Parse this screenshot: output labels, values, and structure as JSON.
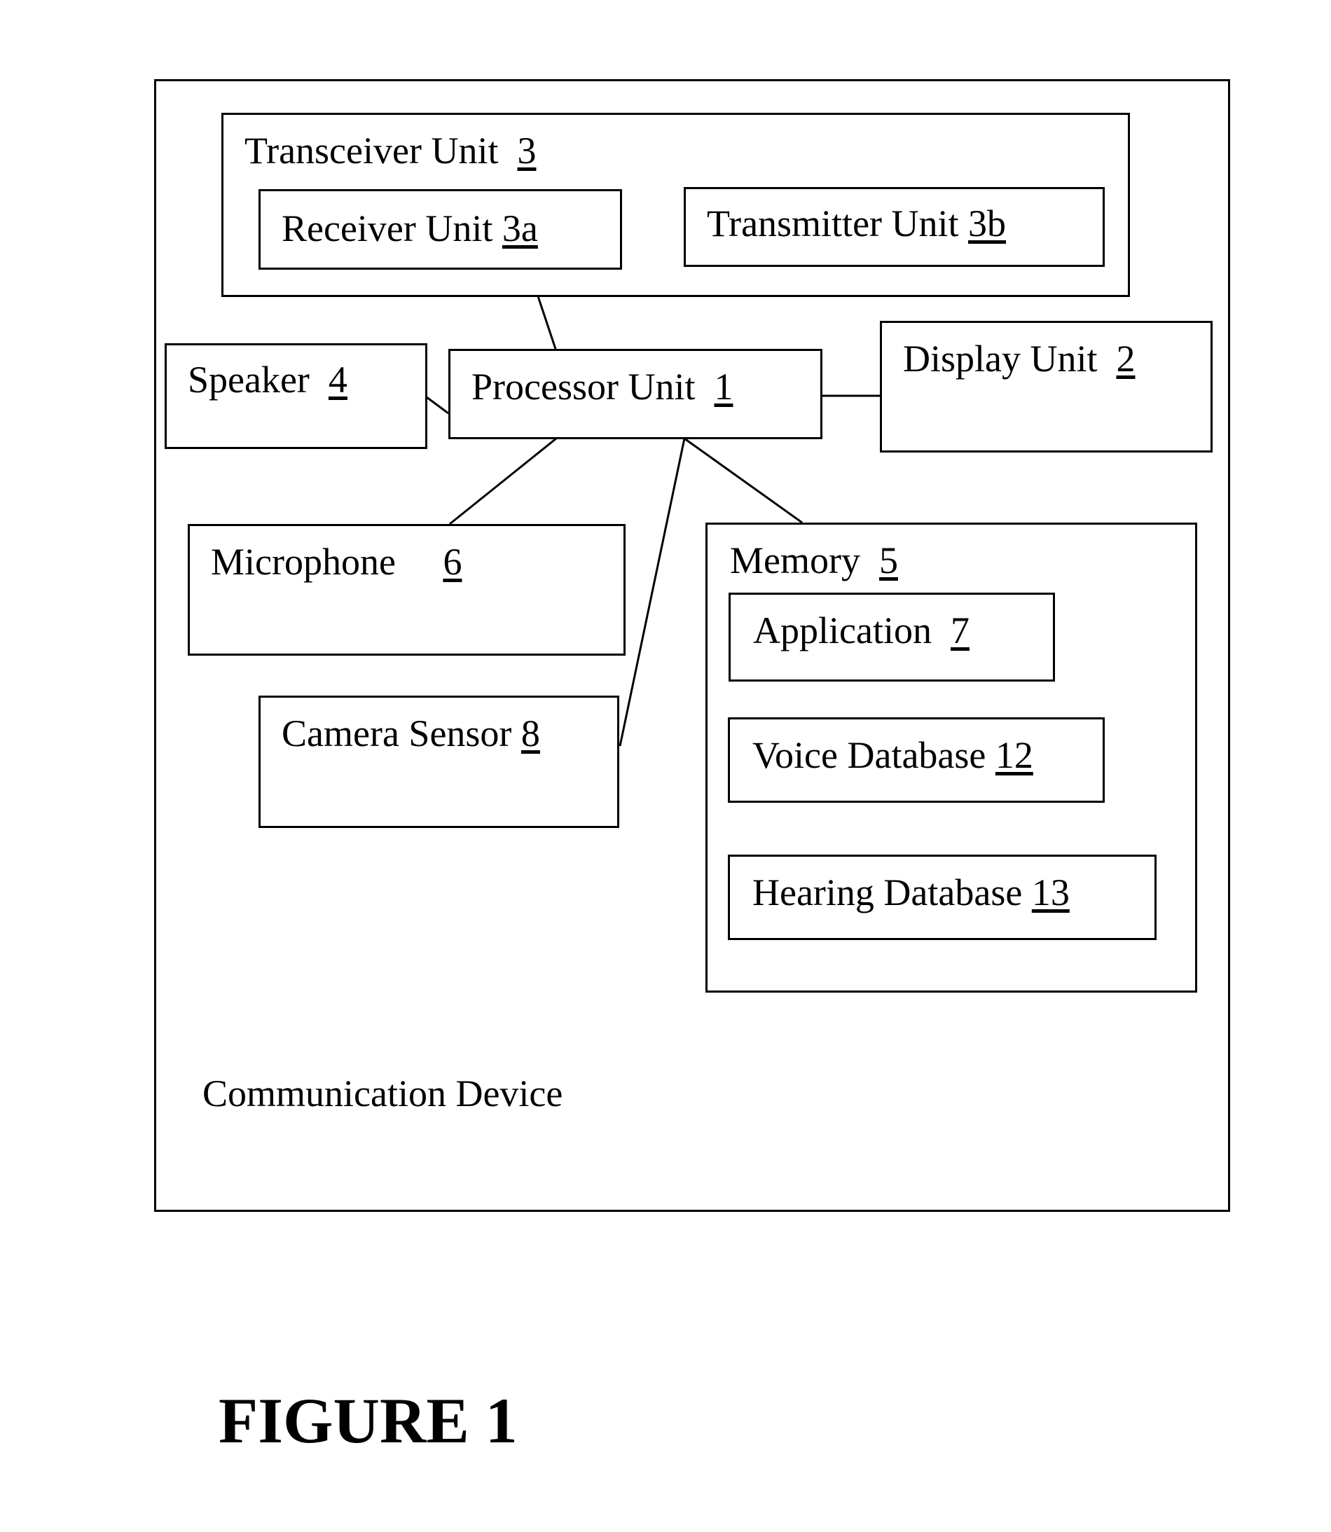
{
  "figure": {
    "caption": "FIGURE 1",
    "device_label": "Communication Device"
  },
  "blocks": {
    "transceiver": {
      "name": "Transceiver Unit",
      "ref": "3"
    },
    "receiver": {
      "name": "Receiver Unit",
      "ref": "3a"
    },
    "transmitter": {
      "name": "Transmitter Unit",
      "ref": "3b"
    },
    "speaker": {
      "name": "Speaker",
      "ref": "4"
    },
    "processor": {
      "name": "Processor Unit",
      "ref": "1"
    },
    "display": {
      "name": "Display Unit",
      "ref": "2"
    },
    "microphone": {
      "name": "Microphone",
      "ref": "6"
    },
    "memory": {
      "name": "Memory",
      "ref": "5"
    },
    "application": {
      "name": "Application",
      "ref": "7"
    },
    "camera": {
      "name": "Camera Sensor",
      "ref": "8"
    },
    "voice_db": {
      "name": "Voice Database",
      "ref": "12"
    },
    "hearing_db": {
      "name": "Hearing Database",
      "ref": "13"
    }
  },
  "connections": [
    {
      "from": "processor",
      "to": "transceiver"
    },
    {
      "from": "processor",
      "to": "speaker"
    },
    {
      "from": "processor",
      "to": "display"
    },
    {
      "from": "processor",
      "to": "microphone"
    },
    {
      "from": "processor",
      "to": "camera"
    },
    {
      "from": "processor",
      "to": "memory"
    }
  ]
}
